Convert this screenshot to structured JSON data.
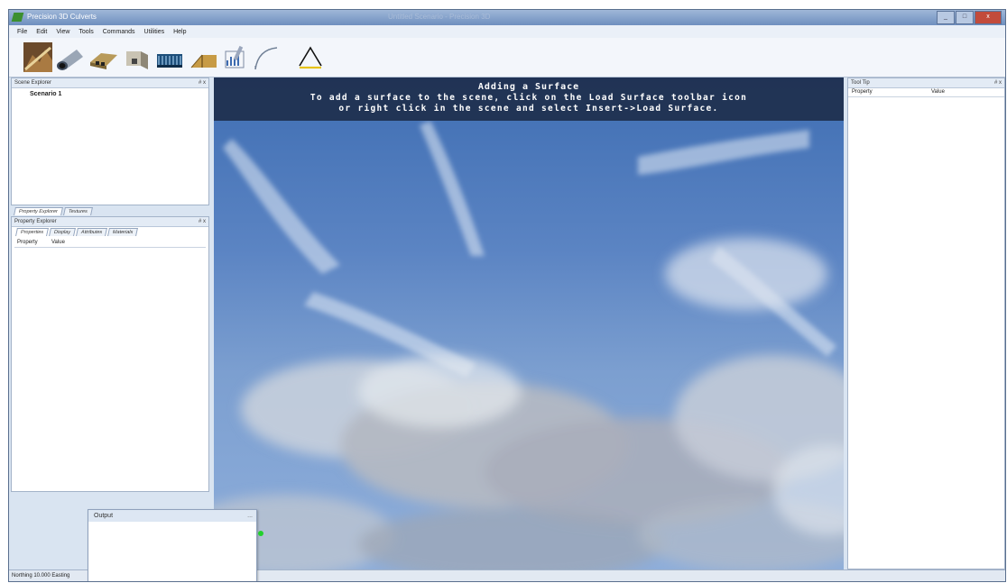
{
  "window": {
    "app_title": "Precision 3D Culverts",
    "window_title": "Untitled Scenario - Precision 3D",
    "min_label": "_",
    "max_label": "□",
    "close_label": "x"
  },
  "menu": [
    "File",
    "Edit",
    "View",
    "Tools",
    "Commands",
    "Utilities",
    "Help"
  ],
  "toolbar": {
    "icons": [
      "terrain-icon",
      "culvert-pipe-icon",
      "box-culvert-icon",
      "headwall-icon",
      "gabion-icon",
      "wingwall-icon",
      "chart-icon",
      "curve-icon",
      "load-surface-icon"
    ]
  },
  "scene_explorer": {
    "title": "Scene Explorer",
    "pin": "# x",
    "items": [
      "Scenario 1"
    ]
  },
  "lower_tabs": [
    "Property Explorer",
    "Textures"
  ],
  "property_explorer": {
    "title": "Property Explorer",
    "pin": "# x",
    "tabs": [
      "Properties",
      "Display",
      "Attributes",
      "Materials"
    ],
    "columns": [
      "Property",
      "Value"
    ]
  },
  "tooltip_panel": {
    "title": "Tool Tip",
    "pin": "# x",
    "columns": [
      "Property",
      "Value"
    ]
  },
  "viewport": {
    "banner_title": "Adding a Surface",
    "banner_line1": "To add a surface to the scene, click on the Load Surface toolbar icon",
    "banner_line2": "or right click in the scene and select Insert->Load Surface."
  },
  "output": {
    "title": "Output",
    "close": "..."
  },
  "status": {
    "text": "Northing 10.000  Easting"
  },
  "colors": {
    "banner_bg": "#1c2b48",
    "sky_top": "#3f6eb3",
    "sky_bottom": "#8eaedb",
    "frame": "#d9e4f1"
  }
}
